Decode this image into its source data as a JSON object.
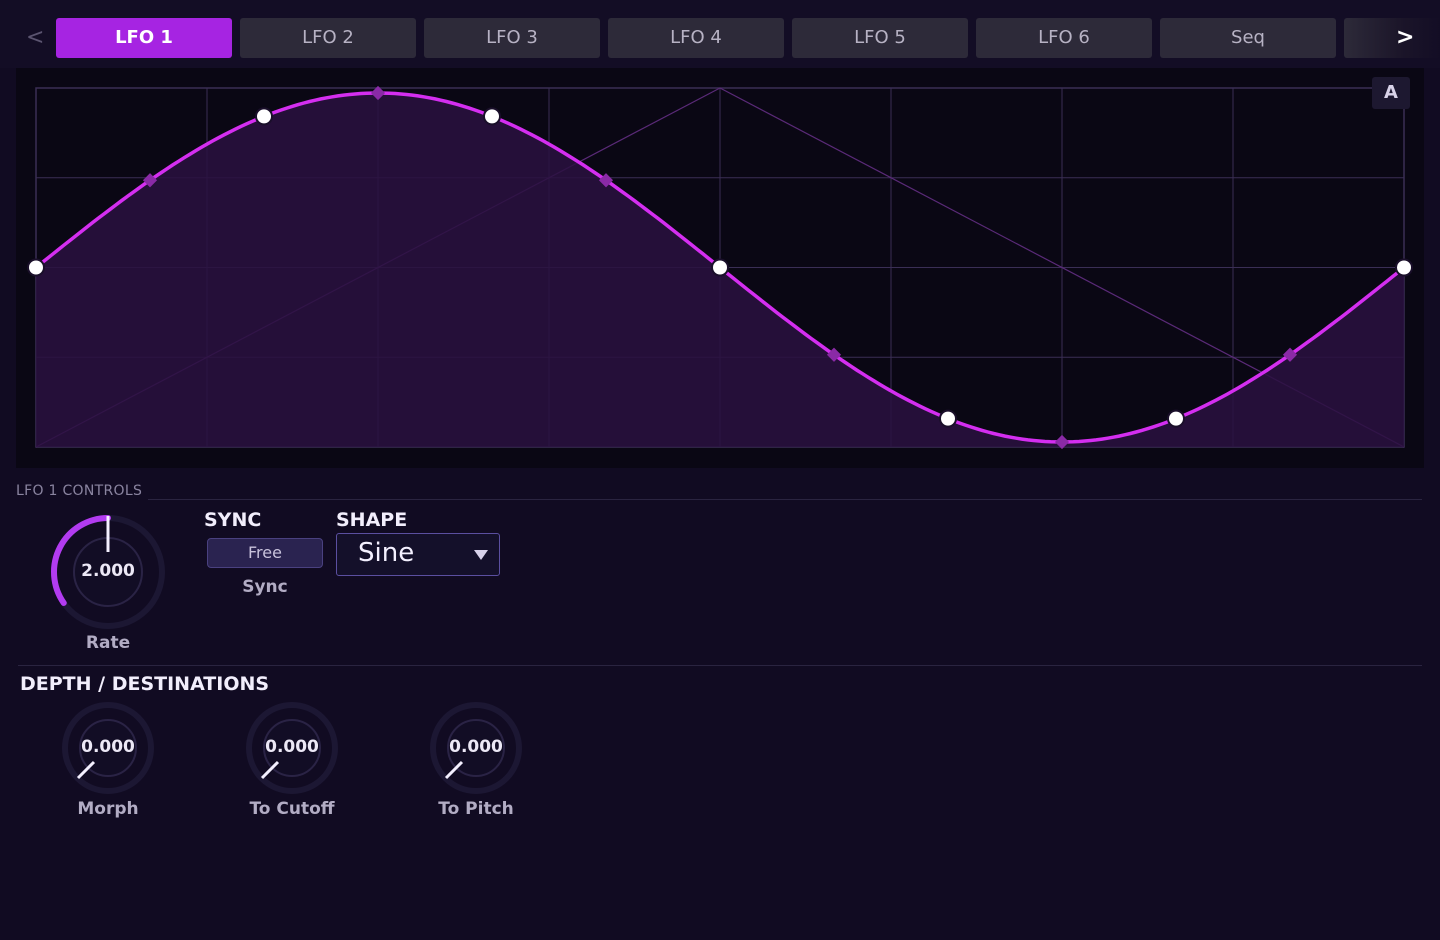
{
  "tabs": {
    "prev_label": "<",
    "next_label": ">",
    "items": [
      {
        "label": "LFO 1",
        "active": true
      },
      {
        "label": "LFO 2",
        "active": false
      },
      {
        "label": "LFO 3",
        "active": false
      },
      {
        "label": "LFO 4",
        "active": false
      },
      {
        "label": "LFO 5",
        "active": false
      },
      {
        "label": "LFO 6",
        "active": false
      },
      {
        "label": "Seq",
        "active": false
      }
    ]
  },
  "graph": {
    "badge": "A",
    "waveform": "sine",
    "curve_color": "#d42ef0",
    "fill_color": "#2a1040",
    "grid_color": "#3a2e55",
    "ghost_line_color": "#5a2a78",
    "grid_columns": 8,
    "grid_rows": 4
  },
  "controls": {
    "section_label": "LFO 1 CONTROLS",
    "rate": {
      "value": "2.000",
      "label": "Rate",
      "accent": "#b23bf0"
    },
    "sync": {
      "title": "SYNC",
      "button_label": "Free",
      "toggle_label": "Sync"
    },
    "shape": {
      "title": "SHAPE",
      "value": "Sine"
    }
  },
  "depth": {
    "title": "DEPTH / DESTINATIONS",
    "knobs": [
      {
        "value": "0.000",
        "label": "Morph"
      },
      {
        "value": "0.000",
        "label": "To Cutoff"
      },
      {
        "value": "0.000",
        "label": "To Pitch"
      }
    ]
  }
}
